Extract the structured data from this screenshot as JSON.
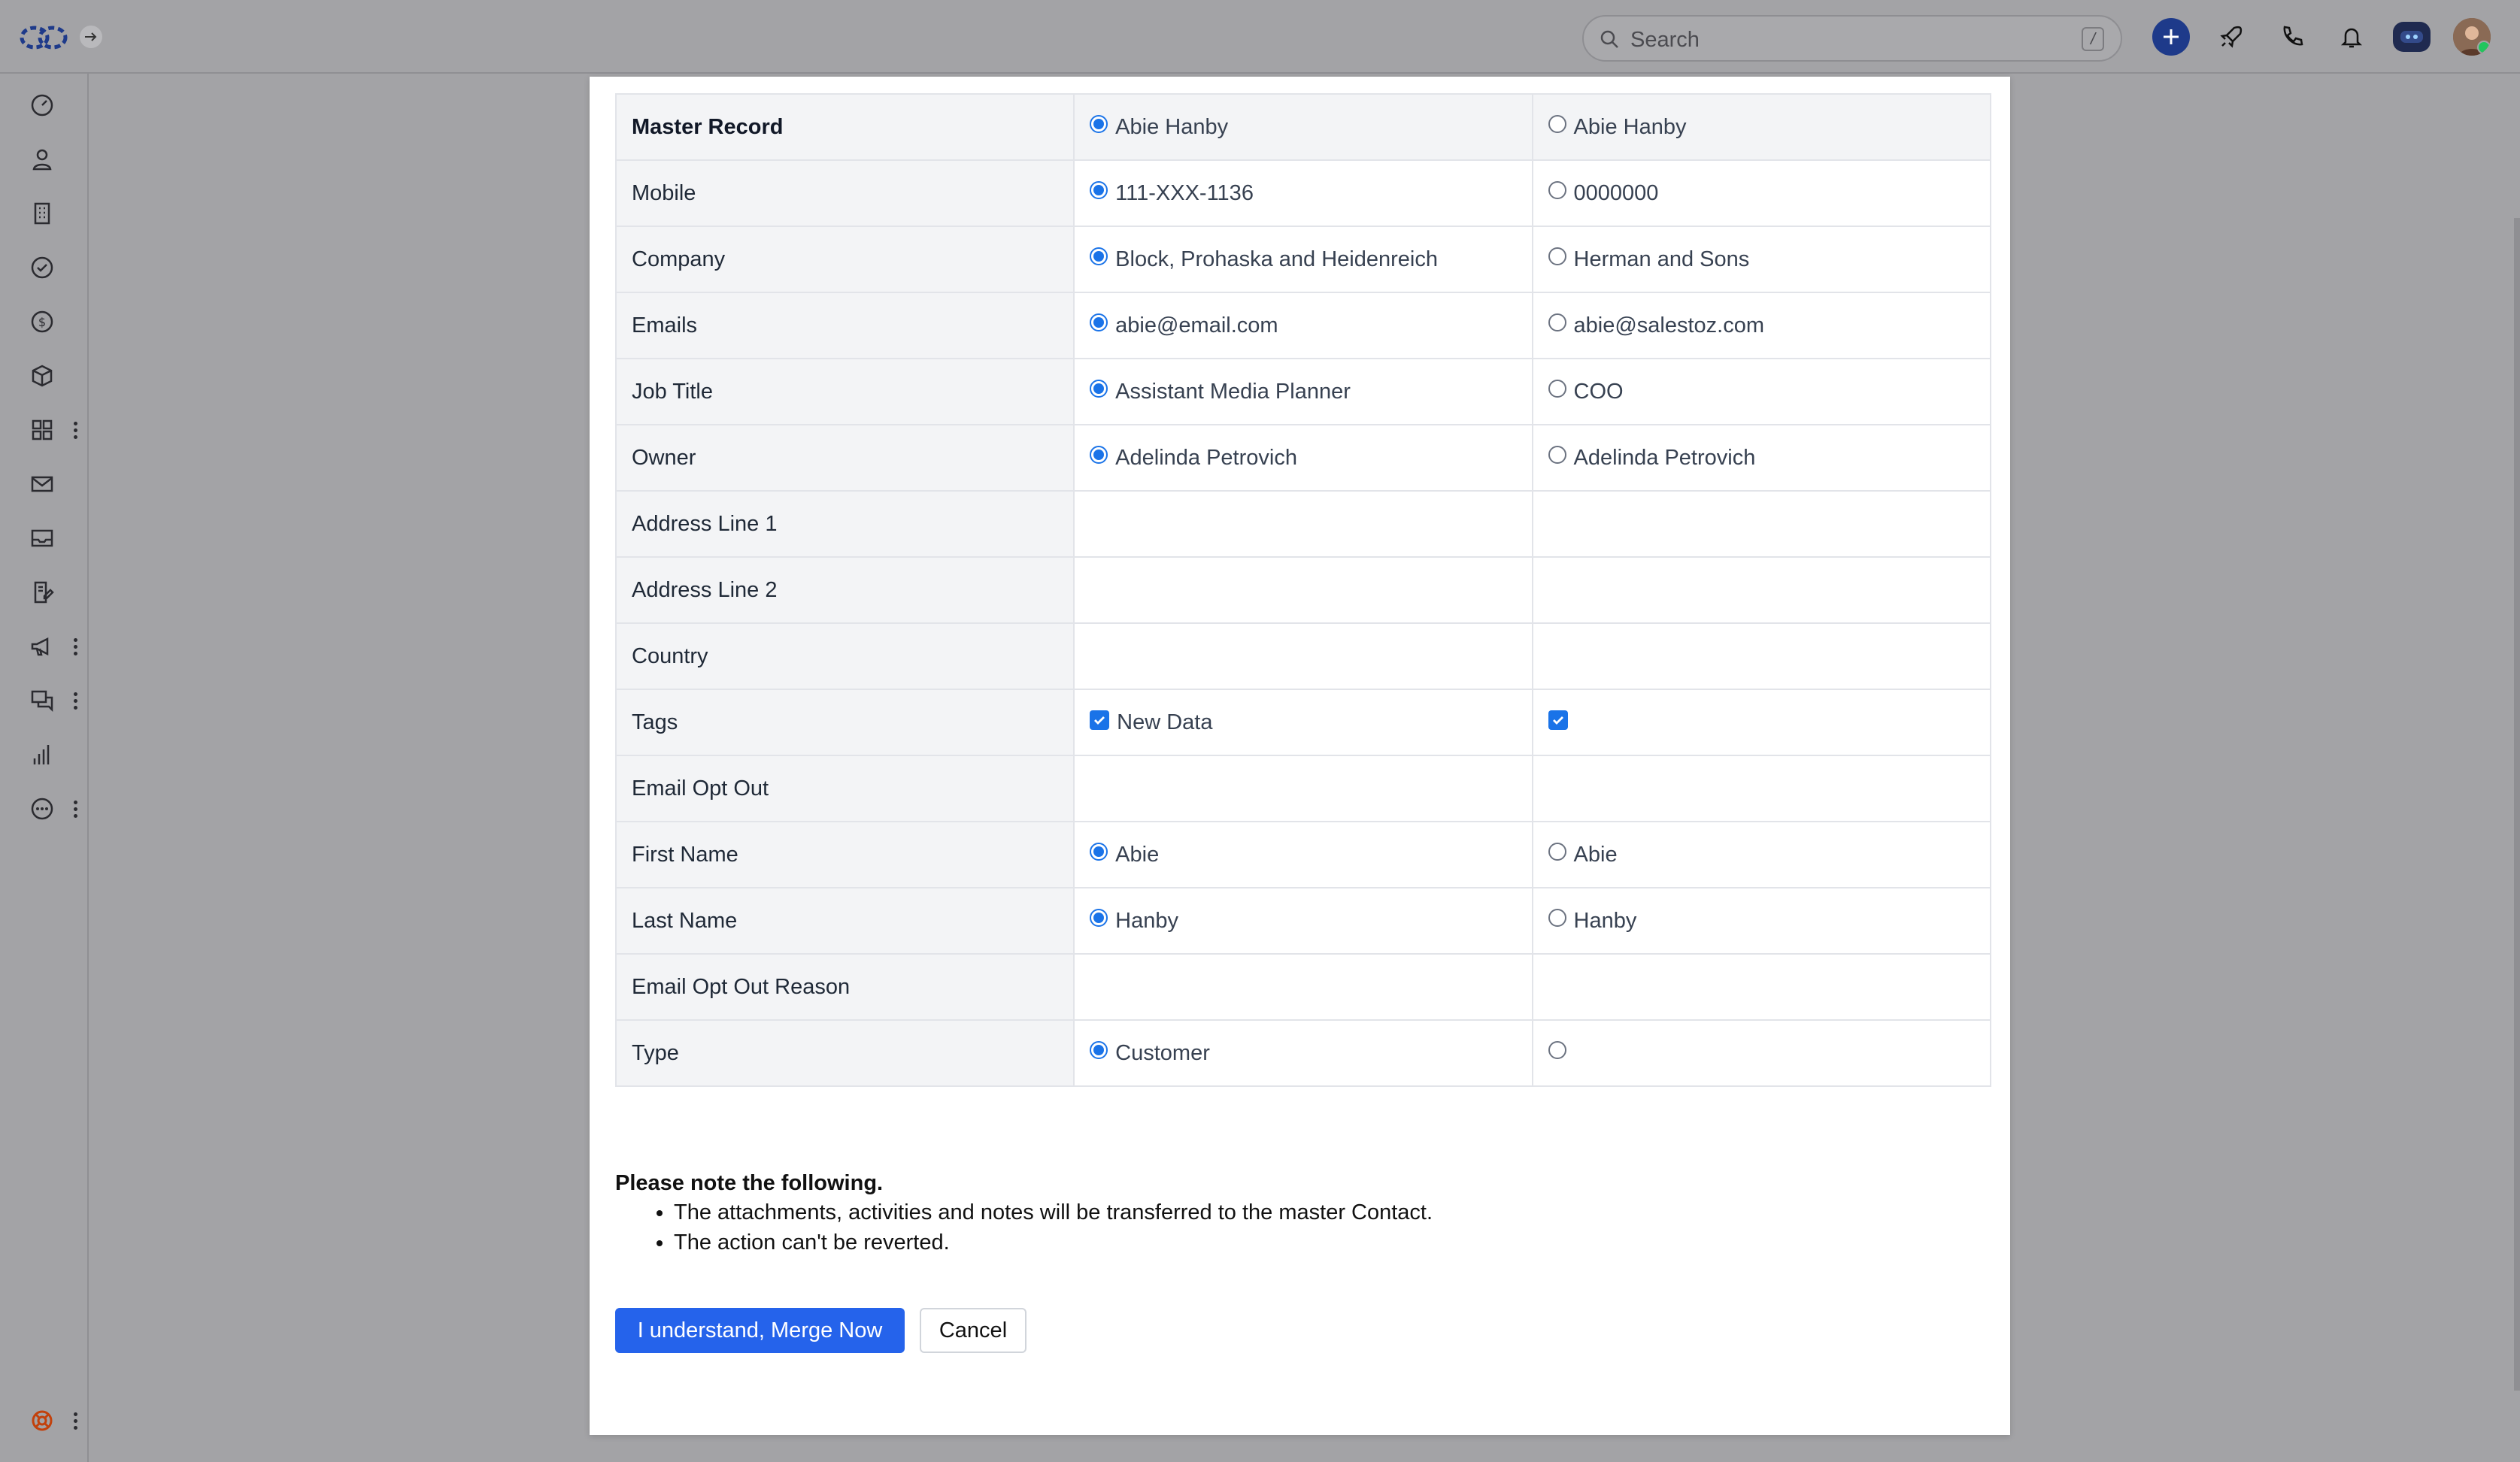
{
  "topbar": {
    "search_placeholder": "Search",
    "search_shortcut": "/"
  },
  "sidebar": {
    "items": [
      {
        "icon": "dashboard-gauge-icon"
      },
      {
        "icon": "contacts-person-icon"
      },
      {
        "icon": "companies-building-icon"
      },
      {
        "icon": "tasks-check-icon"
      },
      {
        "icon": "deals-dollar-icon"
      },
      {
        "icon": "products-box-icon"
      },
      {
        "icon": "apps-grid-icon"
      },
      {
        "icon": "mail-icon"
      },
      {
        "icon": "inbox-icon"
      },
      {
        "icon": "documents-sign-icon"
      },
      {
        "icon": "campaigns-megaphone-icon"
      },
      {
        "icon": "chat-icon"
      },
      {
        "icon": "reports-bar-chart-icon"
      },
      {
        "icon": "more-icon"
      }
    ],
    "help_icon": "lifebuoy-icon"
  },
  "merge": {
    "header": {
      "label": "Master Record",
      "left": "Abie Hanby",
      "right": "Abie Hanby",
      "selected": "left"
    },
    "rows": [
      {
        "label": "Mobile",
        "left": "111-XXX-1136",
        "right": "0000000",
        "kind": "radio"
      },
      {
        "label": "Company",
        "left": "Block, Prohaska and Heidenreich",
        "right": "Herman and Sons",
        "kind": "radio"
      },
      {
        "label": "Emails",
        "left": "abie@email.com",
        "right": "abie@salestoz.com",
        "kind": "radio"
      },
      {
        "label": "Job Title",
        "left": "Assistant Media Planner",
        "right": "COO",
        "kind": "radio"
      },
      {
        "label": "Owner",
        "left": "Adelinda Petrovich",
        "right": "Adelinda Petrovich",
        "kind": "radio"
      },
      {
        "label": "Address Line 1",
        "left": "",
        "right": "",
        "kind": "empty"
      },
      {
        "label": "Address Line 2",
        "left": "",
        "right": "",
        "kind": "empty"
      },
      {
        "label": "Country",
        "left": "",
        "right": "",
        "kind": "empty"
      },
      {
        "label": "Tags",
        "left": "New Data",
        "right": "",
        "kind": "checkbox"
      },
      {
        "label": "Email Opt Out",
        "left": "",
        "right": "",
        "kind": "empty"
      },
      {
        "label": "First Name",
        "left": "Abie",
        "right": "Abie",
        "kind": "radio"
      },
      {
        "label": "Last Name",
        "left": "Hanby",
        "right": "Hanby",
        "kind": "radio"
      },
      {
        "label": "Email Opt Out Reason",
        "left": "",
        "right": "",
        "kind": "empty"
      },
      {
        "label": "Type",
        "left": "Customer",
        "right": "",
        "kind": "radio"
      }
    ]
  },
  "notes": {
    "title": "Please note the following.",
    "items": [
      "The attachments, activities and notes will be transferred to the master Contact.",
      "The action can't be reverted."
    ]
  },
  "actions": {
    "merge_label": "I understand, Merge Now",
    "cancel_label": "Cancel"
  },
  "colors": {
    "accent": "#2563eb",
    "radio_selected": "#1a73e8",
    "overlay": "#a3a3a6",
    "label_bg": "#f3f4f6"
  }
}
